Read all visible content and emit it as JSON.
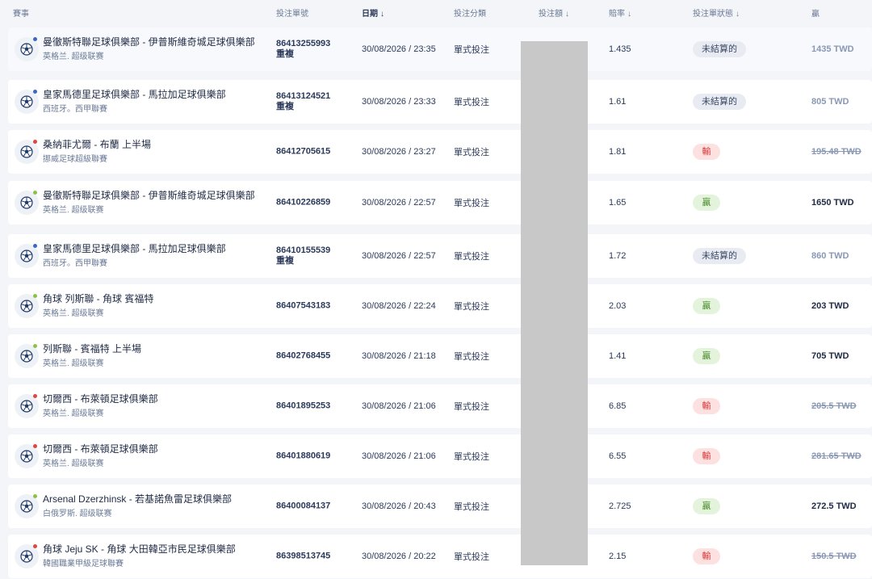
{
  "header": {
    "event": "賽事",
    "ticket": "投注單號",
    "date": "日期",
    "category": "投注分類",
    "stake": "投注額",
    "odds": "賠率",
    "status": "投注單狀態",
    "win": "贏",
    "sort_arrow": "↓"
  },
  "rows": [
    {
      "name": "曼徹斯特聯足球俱樂部 - 伊普斯維奇城足球俱樂部",
      "league": "英格兰. 超级联赛",
      "ticket": "86413255993",
      "tag": "重複",
      "date": "30/08/2026 / 23:35",
      "type": "單式投注",
      "odds": "1.435",
      "status": "未結算的",
      "status_kind": "pending",
      "win": "1435 TWD",
      "dot": "blue"
    },
    {
      "name": "皇家馬德里足球俱樂部 - 馬拉加足球俱樂部",
      "league": "西班牙。西甲聯賽",
      "ticket": "86413124521",
      "tag": "重複",
      "date": "30/08/2026 / 23:33",
      "type": "單式投注",
      "odds": "1.61",
      "status": "未結算的",
      "status_kind": "pending",
      "win": "805 TWD",
      "dot": "blue"
    },
    {
      "name": "桑納菲尤爾 - 布蘭 上半場",
      "league": "挪威足球超級聯賽",
      "ticket": "86412705615",
      "tag": "",
      "date": "30/08/2026 / 23:27",
      "type": "單式投注",
      "odds": "1.81",
      "status": "輸",
      "status_kind": "lose",
      "win": "195.48 TWD",
      "dot": "red"
    },
    {
      "name": "曼徹斯特聯足球俱樂部 - 伊普斯維奇城足球俱樂部",
      "league": "英格兰. 超级联赛",
      "ticket": "86410226859",
      "tag": "",
      "date": "30/08/2026 / 22:57",
      "type": "單式投注",
      "odds": "1.65",
      "status": "贏",
      "status_kind": "win",
      "win": "1650 TWD",
      "dot": "green"
    },
    {
      "name": "皇家馬德里足球俱樂部 - 馬拉加足球俱樂部",
      "league": "西班牙。西甲聯賽",
      "ticket": "86410155539",
      "tag": "重複",
      "date": "30/08/2026 / 22:57",
      "type": "單式投注",
      "odds": "1.72",
      "status": "未結算的",
      "status_kind": "pending",
      "win": "860 TWD",
      "dot": "blue"
    },
    {
      "name": "角球 列斯聯 - 角球 賓福特",
      "league": "英格兰. 超级联赛",
      "ticket": "86407543183",
      "tag": "",
      "date": "30/08/2026 / 22:24",
      "type": "單式投注",
      "odds": "2.03",
      "status": "贏",
      "status_kind": "win",
      "win": "203 TWD",
      "dot": "green"
    },
    {
      "name": "列斯聯 - 賓福特 上半場",
      "league": "英格兰. 超级联赛",
      "ticket": "86402768455",
      "tag": "",
      "date": "30/08/2026 / 21:18",
      "type": "單式投注",
      "odds": "1.41",
      "status": "贏",
      "status_kind": "win",
      "win": "705 TWD",
      "dot": "green"
    },
    {
      "name": "切爾西 - 布萊頓足球俱樂部",
      "league": "英格兰. 超级联赛",
      "ticket": "86401895253",
      "tag": "",
      "date": "30/08/2026 / 21:06",
      "type": "單式投注",
      "odds": "6.85",
      "status": "輸",
      "status_kind": "lose",
      "win": "205.5 TWD",
      "dot": "red"
    },
    {
      "name": "切爾西 - 布萊頓足球俱樂部",
      "league": "英格兰. 超级联赛",
      "ticket": "86401880619",
      "tag": "",
      "date": "30/08/2026 / 21:06",
      "type": "單式投注",
      "odds": "6.55",
      "status": "輸",
      "status_kind": "lose",
      "win": "281.65 TWD",
      "dot": "red"
    },
    {
      "name": "Arsenal Dzerzhinsk - 若基諾魚雷足球俱樂部",
      "league": "白俄罗斯. 超级联赛",
      "ticket": "86400084137",
      "tag": "",
      "date": "30/08/2026 / 20:43",
      "type": "單式投注",
      "odds": "2.725",
      "status": "贏",
      "status_kind": "win",
      "win": "272.5 TWD",
      "dot": "green"
    },
    {
      "name": "角球 Jeju SK - 角球 大田韓亞市民足球俱樂部",
      "league": "韓國職業甲級足球聯賽",
      "ticket": "86398513745",
      "tag": "",
      "date": "30/08/2026 / 20:22",
      "type": "單式投注",
      "odds": "2.15",
      "status": "輸",
      "status_kind": "lose",
      "win": "150.5 TWD",
      "dot": "red"
    }
  ]
}
